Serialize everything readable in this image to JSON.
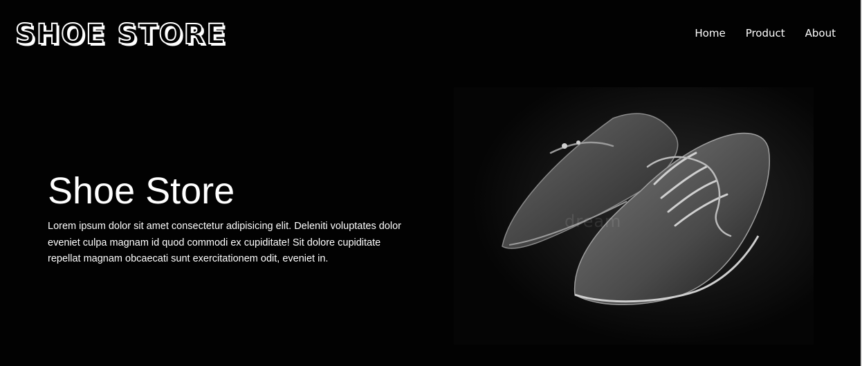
{
  "header": {
    "logo": "SHOE STORE",
    "nav": [
      {
        "label": "Home"
      },
      {
        "label": "Product"
      },
      {
        "label": "About"
      }
    ]
  },
  "hero": {
    "title": "Shoe Store",
    "description": "Lorem ipsum dolor sit amet consectetur adipisicing elit. Deleniti voluptates dolor eveniet culpa magnam id quod commodi ex cupiditate! Sit dolore cupiditate repellat magnam obcaecati sunt exercitationem odit, eveniet in.",
    "image_watermark": "dream"
  },
  "colors": {
    "background": "#000000",
    "text": "#ffffff"
  }
}
